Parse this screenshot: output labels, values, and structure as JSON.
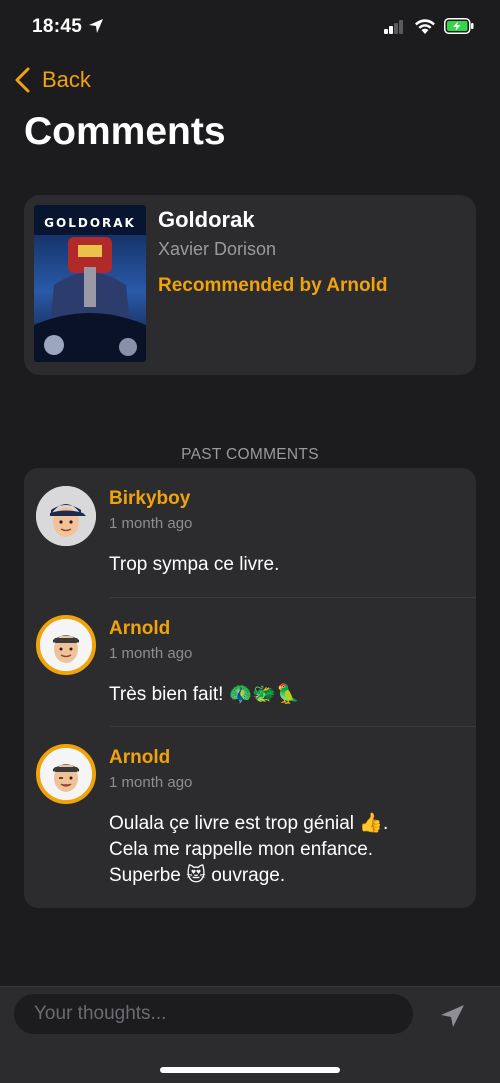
{
  "status_bar": {
    "time": "18:45"
  },
  "nav": {
    "back_label": "Back",
    "title": "Comments"
  },
  "book": {
    "title": "Goldorak",
    "author": "Xavier Dorison",
    "recommendation": "Recommended by Arnold",
    "cover_text": "GOLDORAK"
  },
  "section": {
    "past_comments": "PAST COMMENTS"
  },
  "comments": [
    {
      "author": "Birkyboy",
      "time": "1 month ago",
      "text": "Trop sympa ce livre."
    },
    {
      "author": "Arnold",
      "time": "1 month ago",
      "text": "Très bien fait! 🦚🐲🦜"
    },
    {
      "author": "Arnold",
      "time": "1 month ago",
      "text": "Oulala çe livre est trop génial 👍.\nCela me rappelle mon enfance.\nSuperbe 😻 ouvrage."
    }
  ],
  "composer": {
    "placeholder": "Your thoughts..."
  },
  "colors": {
    "accent": "#f0a30a",
    "background": "#1c1c1e",
    "card": "#2c2c2e",
    "secondary_text": "#9a9a9e"
  }
}
